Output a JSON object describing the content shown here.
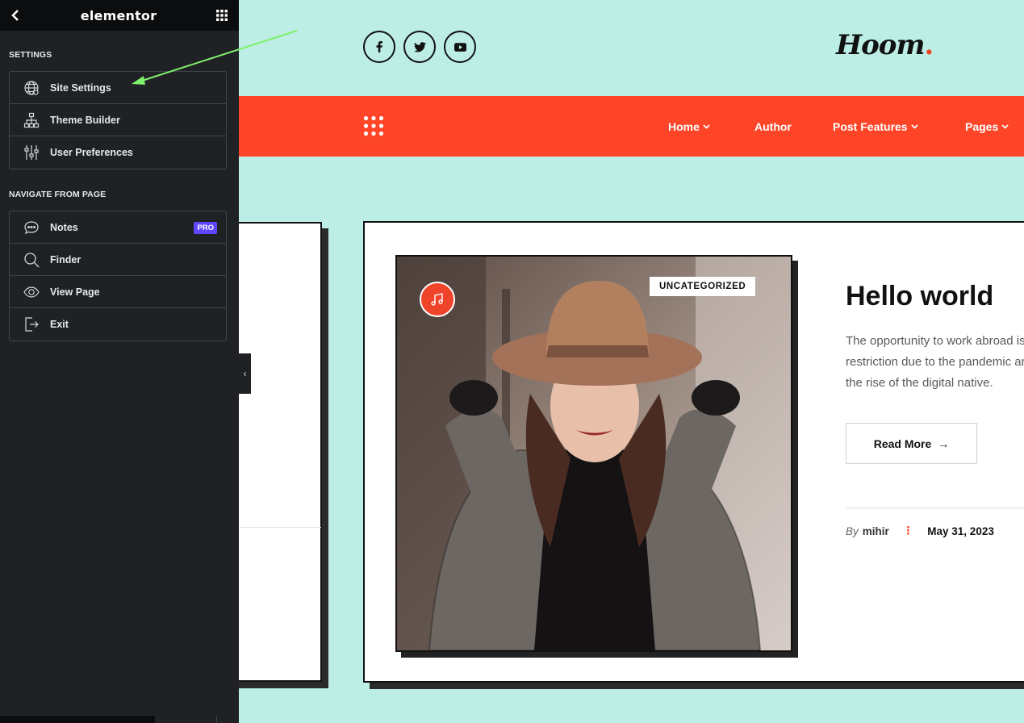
{
  "panel": {
    "title": "elementor",
    "settings_heading": "SETTINGS",
    "settings_items": [
      {
        "label": "Site Settings",
        "icon": "globe-icon"
      },
      {
        "label": "Theme Builder",
        "icon": "sitemap-icon"
      },
      {
        "label": "User Preferences",
        "icon": "sliders-icon"
      }
    ],
    "navigate_heading": "NAVIGATE FROM PAGE",
    "navigate_items": [
      {
        "label": "Notes",
        "icon": "chat-icon",
        "badge": "PRO"
      },
      {
        "label": "Finder",
        "icon": "search-icon"
      },
      {
        "label": "View Page",
        "icon": "eye-icon"
      },
      {
        "label": "Exit",
        "icon": "exit-icon"
      }
    ],
    "collapse_glyph": "‹"
  },
  "site": {
    "logo": "Hoom",
    "logo_dot": ".",
    "social": [
      "facebook-icon",
      "twitter-icon",
      "youtube-icon"
    ],
    "nav": [
      {
        "label": "Home",
        "has_dropdown": true
      },
      {
        "label": "Author",
        "has_dropdown": false
      },
      {
        "label": "Post Features",
        "has_dropdown": true
      },
      {
        "label": "Pages",
        "has_dropdown": true
      }
    ],
    "post": {
      "category": "UNCATEGORIZED",
      "title": "Hello world",
      "excerpt_lines": [
        "The opportunity to work abroad is",
        "restriction due to the pandemic ar",
        "the rise of the digital native."
      ],
      "read_more": "Read More",
      "read_more_arrow": "→",
      "by": "By",
      "author": "mihir",
      "separator": "⋮",
      "date": "May 31, 2023"
    }
  },
  "colors": {
    "panel_bg": "#1f2124",
    "site_bg": "#bdeee5",
    "nav_bg": "#ff4527",
    "pro_badge": "#5e47ff",
    "annotation_arrow": "#7ff06b"
  }
}
